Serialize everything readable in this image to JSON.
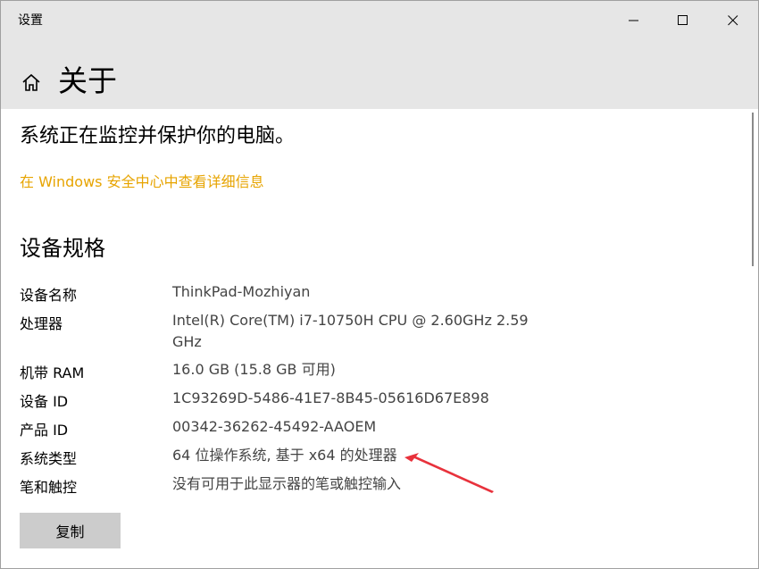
{
  "window": {
    "title": "设置",
    "minimize_icon": "minimize-icon",
    "maximize_icon": "maximize-icon",
    "close_icon": "close-icon"
  },
  "header": {
    "home_icon": "home-icon",
    "title": "关于"
  },
  "protection": {
    "status": "系统正在监控并保护你的电脑。",
    "link": "在 Windows 安全中心中查看详细信息",
    "link_color": "#e7a400"
  },
  "specs": {
    "title": "设备规格",
    "rows": [
      {
        "label": "设备名称",
        "value": "ThinkPad-Mozhiyan"
      },
      {
        "label": "处理器",
        "value": "Intel(R) Core(TM) i7-10750H CPU @ 2.60GHz   2.59",
        "value2": "GHz"
      },
      {
        "label": "机带 RAM",
        "value": "16.0 GB (15.8 GB 可用)"
      },
      {
        "label": "设备 ID",
        "value": "1C93269D-5486-41E7-8B45-05616D67E898"
      },
      {
        "label": "产品 ID",
        "value": "00342-36262-45492-AAOEM"
      },
      {
        "label": "系统类型",
        "value": "64 位操作系统, 基于 x64 的处理器"
      },
      {
        "label": "笔和触控",
        "value": "没有可用于此显示器的笔或触控输入"
      }
    ],
    "copy_button": "复制"
  },
  "annotation": {
    "arrow_color": "#e8323c"
  }
}
